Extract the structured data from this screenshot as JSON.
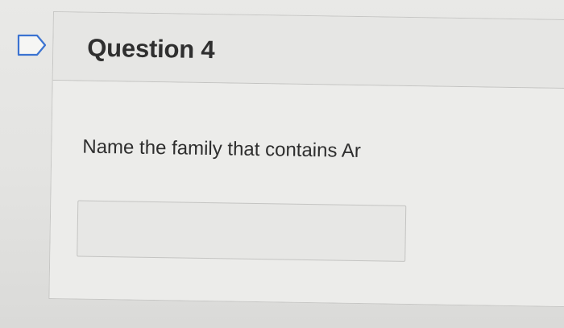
{
  "question": {
    "title": "Question 4",
    "prompt": "Name the family that contains Ar",
    "answer_value": "",
    "flag_icon": "flag-question-icon"
  },
  "colors": {
    "background": "#e4e4e2",
    "card_border": "#c6c6c4",
    "text": "#2f2f2f",
    "flag_stroke": "#3b73d1"
  }
}
